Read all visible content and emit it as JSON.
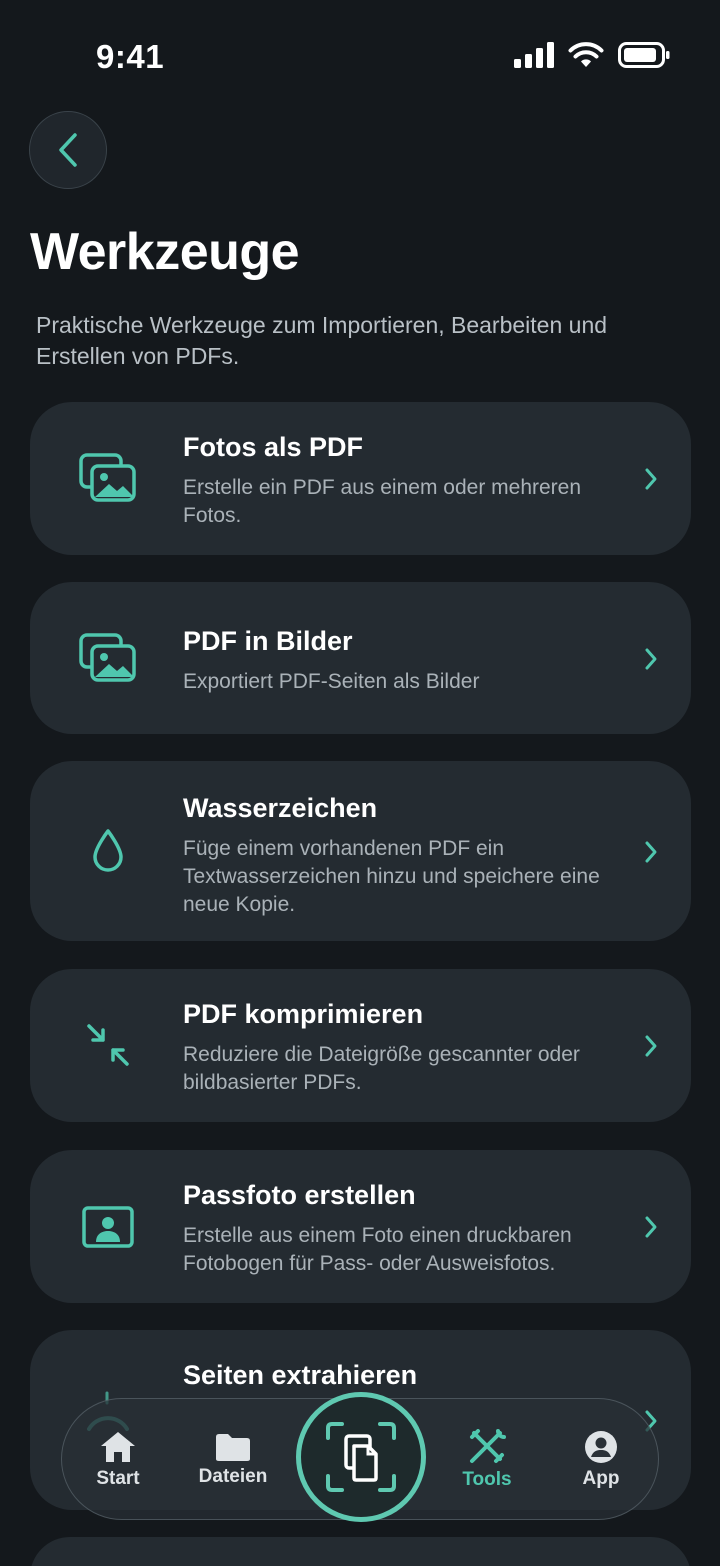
{
  "status_bar": {
    "time": "9:41"
  },
  "header": {
    "title": "Werkzeuge",
    "subtitle": "Praktische Werkzeuge zum Importieren, Bearbeiten und Erstellen von PDFs."
  },
  "tools": [
    {
      "title": "Fotos als PDF",
      "description": "Erstelle ein PDF aus einem oder mehreren Fotos.",
      "icon": "images-icon"
    },
    {
      "title": "PDF in Bilder",
      "description": "Exportiert PDF-Seiten als Bilder",
      "icon": "images-icon"
    },
    {
      "title": "Wasserzeichen",
      "description": "Füge einem vorhandenen PDF ein Textwasserzeichen hinzu und speichere eine neue Kopie.",
      "icon": "droplet-icon"
    },
    {
      "title": "PDF komprimieren",
      "description": "Reduziere die Dateigröße gescannter oder bildbasierter PDFs.",
      "icon": "compress-arrows-icon"
    },
    {
      "title": "Passfoto erstellen",
      "description": "Erstelle aus einem Foto einen druckbaren Fotobogen für Pass- oder Ausweisfotos.",
      "icon": "portrait-icon"
    },
    {
      "title": "Seiten extrahieren",
      "description": "",
      "icon": "extract-icon"
    }
  ],
  "tab_bar": {
    "items": [
      {
        "label": "Start",
        "icon": "home-icon"
      },
      {
        "label": "Dateien",
        "icon": "folder-icon"
      },
      {
        "label": "Tools",
        "icon": "tools-icon",
        "active": true
      },
      {
        "label": "App",
        "icon": "account-icon"
      }
    ],
    "scan_icon": "scan-document-icon"
  },
  "colors": {
    "accent": "#4fc7ae",
    "background": "#14181c",
    "card": "#242b31"
  }
}
